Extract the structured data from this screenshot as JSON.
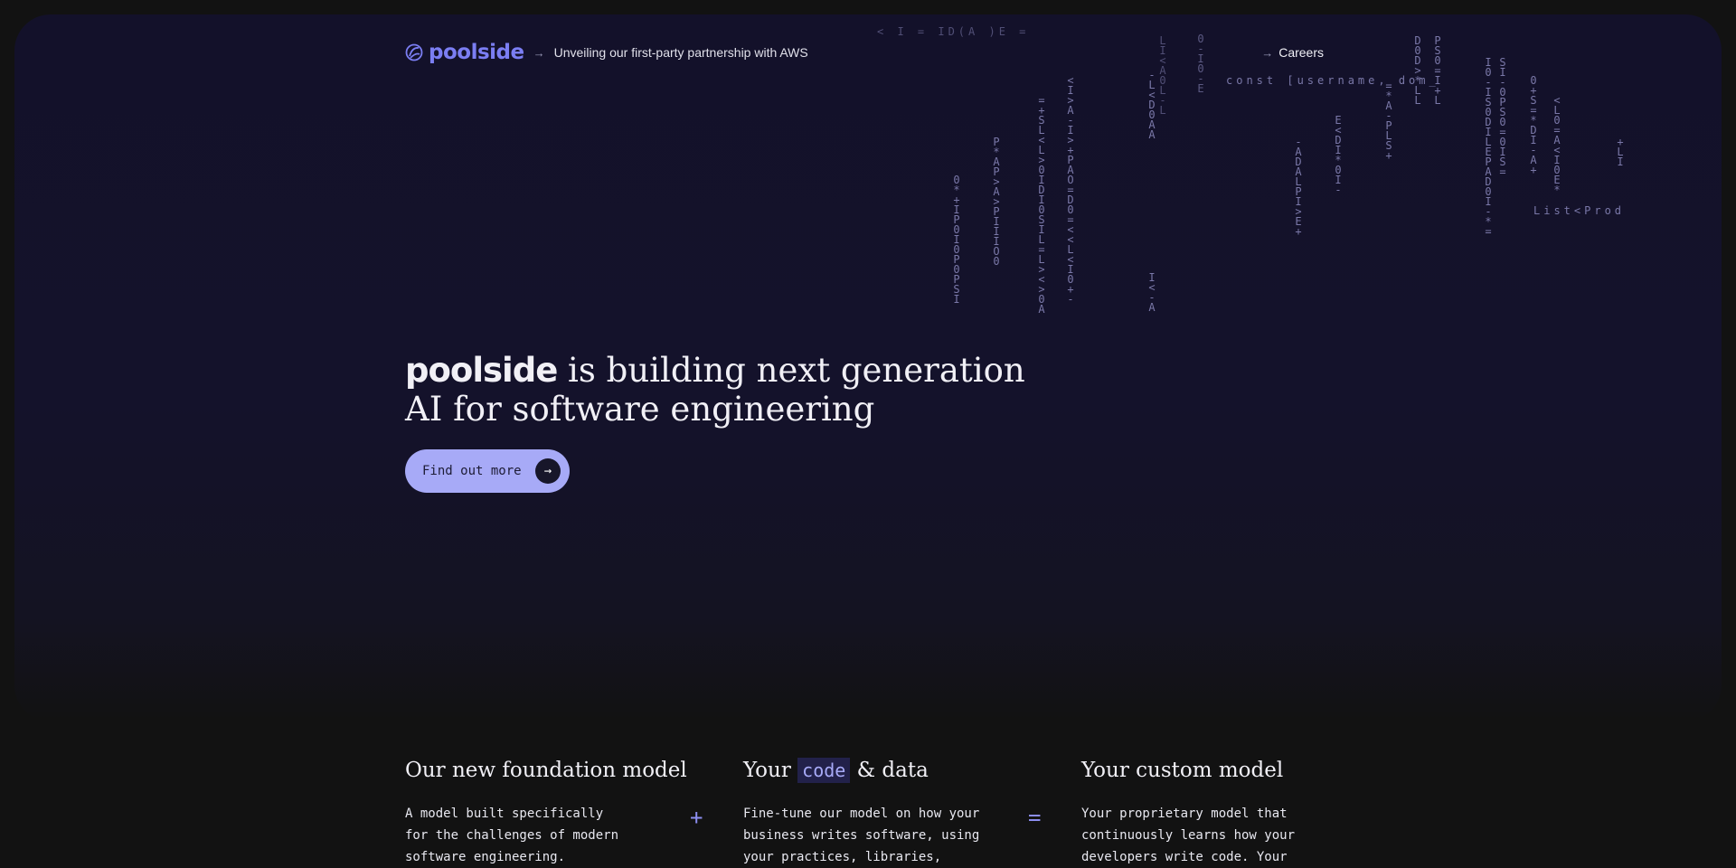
{
  "nav": {
    "logo_text": "poolside",
    "logo_icon": "poolside-swirl-icon",
    "announcement": "Unveiling our first-party partnership with AWS",
    "careers_label": "Careers"
  },
  "hero": {
    "brand": "poolside",
    "headline_rest": " is building next generation AI for software engineering",
    "cta_label": "Find out more"
  },
  "code_rain": {
    "columns": [
      "0*+IP0I0P0PSI",
      "P*AP>A>PIIIO0",
      "=+SL<L>0IDI0SIL=L><>0A",
      "<I>A-I>+PAO=D0=<<L<I0+-",
      "-L<D0AA",
      "LI<A0L-L",
      "I<-A",
      "0-I0-E",
      "-ADALPI>E+",
      "E<DI*0I-",
      "=*A-PLS+",
      "D0D>*LL",
      "PS0=I+L",
      "I0-IS0DILEPAD0I-*=",
      "SI-0PS0=0IS=",
      "0+S=*DI-A+",
      "<L0=A<I0E*",
      "+LI"
    ],
    "rows": [
      "const [username, dom_",
      "List<Prod",
      "< I = ID(A )E ="
    ]
  },
  "features": [
    {
      "title": "Our new foundation model",
      "body": "A model built specifically\nfor the challenges of modern\nsoftware engineering."
    },
    {
      "title_before": "Your",
      "title_code": "code",
      "title_after": "& data",
      "body": "Fine-tune our model on how your\nbusiness writes software, using\nyour practices, libraries,"
    },
    {
      "title": "Your custom model",
      "body": "Your proprietary model that\ncontinuously learns how your\ndevelopers write code. Your"
    }
  ],
  "operators": {
    "plus": "+",
    "equals": "="
  },
  "colors": {
    "accent": "#7b7ef3",
    "cta_bg": "#a7aaf7",
    "hero_bg": "#13112a",
    "page_bg": "#121212"
  }
}
